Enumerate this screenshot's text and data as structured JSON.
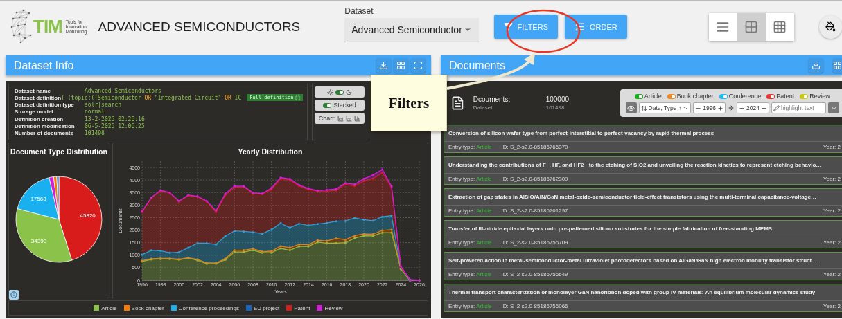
{
  "header": {
    "logo": {
      "mark": "TIM",
      "tagline": "Tools for Innovation Monitoring"
    },
    "title": "ADVANCED SEMICONDUCTORS",
    "dataset_label": "Dataset",
    "dataset_value": "Advanced Semiconductor",
    "filters_button": "FILTERS",
    "order_button": "ORDER",
    "view_modes": [
      {
        "kind": "list",
        "selected": false
      },
      {
        "kind": "grid4",
        "selected": true
      },
      {
        "kind": "grid9",
        "selected": false
      }
    ]
  },
  "annotation": {
    "callout": "Filters"
  },
  "dataset_info": {
    "title": "Dataset Info",
    "fields": [
      {
        "label": "Dataset name",
        "parts": [
          {
            "kind": "plain",
            "text": "Advanced Semiconductors"
          }
        ]
      },
      {
        "label": "Dataset definition",
        "parts": [
          {
            "kind": "plain",
            "text": "( (topic:((Semiconductor "
          },
          {
            "kind": "keyword",
            "text": "OR"
          },
          {
            "kind": "plain",
            "text": " \"Integrated Circuit\" "
          },
          {
            "kind": "keyword",
            "text": "OR"
          },
          {
            "kind": "plain",
            "text": " IC"
          }
        ],
        "badge": "Full definition"
      },
      {
        "label": "Dataset definition type",
        "parts": [
          {
            "kind": "plain",
            "text": "solr|search"
          }
        ]
      },
      {
        "label": "Storage model",
        "parts": [
          {
            "kind": "plain",
            "text": "normal"
          }
        ]
      },
      {
        "label": "Definition creation",
        "parts": [
          {
            "kind": "plain",
            "text": "13-2-2025 02:26:16"
          }
        ]
      },
      {
        "label": "Definition modification",
        "parts": [
          {
            "kind": "plain",
            "text": "06-5-2025 12:06:25"
          }
        ]
      },
      {
        "label": "Number of documents",
        "parts": [
          {
            "kind": "plain",
            "text": "101498"
          }
        ]
      }
    ],
    "dark_mode": true,
    "stacked": {
      "label": "Stacked",
      "on": true
    },
    "chart_label": "Chart:",
    "pie": {
      "title": "Document Type Distribution",
      "chart_data": {
        "type": "pie",
        "colors": [
          "#d81b1b",
          "#8bc34a",
          "#1ab0f0",
          "#d21fd8",
          "#f57c00",
          "#1565c0"
        ],
        "values": [
          45820,
          34390,
          17568,
          1700,
          1200,
          820
        ],
        "value_labels": [
          "45820",
          "34390",
          "17568",
          null,
          null,
          null
        ]
      }
    },
    "yearly": {
      "title": "Yearly Distribution",
      "chart_data": {
        "type": "area",
        "stacked": true,
        "xlabel": "Years",
        "ylabel": "Documents",
        "x": [
          1996,
          1997,
          1998,
          1999,
          2000,
          2001,
          2002,
          2003,
          2004,
          2005,
          2006,
          2007,
          2008,
          2009,
          2010,
          2011,
          2012,
          2013,
          2014,
          2015,
          2016,
          2017,
          2018,
          2019,
          2020,
          2021,
          2022,
          2023,
          2024,
          2025,
          2026
        ],
        "xticks": [
          1996,
          1998,
          2000,
          2002,
          2004,
          2006,
          2008,
          2010,
          2012,
          2014,
          2016,
          2018,
          2020,
          2022,
          2024,
          2026
        ],
        "yticks": [
          0,
          500,
          1000,
          1500,
          2000,
          2500,
          3000,
          3500,
          4000,
          4500
        ],
        "ylim": [
          0,
          4750
        ],
        "xlim": [
          1996,
          2026
        ],
        "grid": true,
        "series": [
          {
            "name": "Article",
            "color": "#8bc34a",
            "values": [
              750,
              830,
              850,
              850,
              820,
              880,
              800,
              660,
              660,
              820,
              1130,
              1130,
              1200,
              1100,
              1100,
              1270,
              1200,
              1350,
              1350,
              1520,
              1480,
              1480,
              1500,
              1680,
              1780,
              1770,
              1900,
              1900,
              450,
              0,
              0
            ]
          },
          {
            "name": "Book chapter",
            "color": "#f57c00",
            "values": [
              30,
              30,
              20,
              20,
              20,
              20,
              30,
              30,
              30,
              40,
              70,
              70,
              60,
              40,
              60,
              90,
              100,
              80,
              70,
              80,
              90,
              190,
              120,
              100,
              70,
              70,
              90,
              120,
              30,
              0,
              0
            ]
          },
          {
            "name": "Conference proceedings",
            "color": "#1ab0f0",
            "values": [
              240,
              340,
              310,
              230,
              280,
              400,
              650,
              790,
              740,
              900,
              770,
              750,
              660,
              720,
              860,
              920,
              800,
              830,
              770,
              650,
              720,
              690,
              750,
              710,
              570,
              540,
              550,
              560,
              20,
              0,
              0
            ]
          },
          {
            "name": "EU project",
            "color": "#1565c0",
            "values": [
              null,
              null,
              null,
              null,
              null,
              null,
              null,
              null,
              null,
              null,
              null,
              null,
              null,
              null,
              null,
              null,
              null,
              null,
              null,
              null,
              null,
              null,
              null,
              null,
              null,
              null,
              null,
              null,
              null,
              null,
              null
            ]
          },
          {
            "name": "Patent",
            "color": "#d81b1b",
            "values": [
              1700,
              2080,
              2380,
              2380,
              2020,
              2080,
              1850,
              1660,
              1290,
              1640,
              1730,
              1780,
              1540,
              1580,
              1600,
              1780,
              1900,
              1500,
              1430,
              1300,
              1270,
              1220,
              1460,
              1270,
              1540,
              1680,
              1750,
              1120,
              20,
              20,
              0
            ]
          },
          {
            "name": "Review",
            "color": "#d21fd8",
            "values": [
              30,
              20,
              30,
              20,
              20,
              20,
              20,
              20,
              60,
              50,
              60,
              20,
              30,
              20,
              60,
              40,
              40,
              40,
              40,
              30,
              50,
              60,
              50,
              70,
              90,
              140,
              130,
              50,
              40,
              10,
              0
            ]
          }
        ]
      }
    }
  },
  "documents": {
    "title": "Documents",
    "count_label": "Dcouments:",
    "count": "100000",
    "dataset_label": "Dataset:",
    "dataset_count": "101498",
    "type_toggles": [
      {
        "label": "Article",
        "color": "#22a822",
        "on": true
      },
      {
        "label": "Book chapter",
        "color": "#f08a24",
        "on": true
      },
      {
        "label": "Conference",
        "color": "#29b6f6",
        "on": true
      },
      {
        "label": "Patent",
        "color": "#e53935",
        "on": true
      },
      {
        "label": "Review",
        "color": "#c9c716",
        "on": true
      }
    ],
    "sort": "Date, Type ↑",
    "year_from": "1996",
    "year_to": "2024",
    "highlight_placeholder": "highlight text",
    "items": [
      {
        "title": "Conversion of silicon wafer type from perfect-interstitial to perfect-vacancy by rapid thermal process",
        "entry_label": "Entry type:",
        "entry_type": "Article",
        "id": "ID: S_2-s2.0-85186766370",
        "year": "Year: 2"
      },
      {
        "title": "Understanding the contributions of F−, HF, and HF2− to the etching of SiO2 and unveiling the reaction kinetics to represent etching behavio…",
        "entry_label": "Entry type:",
        "entry_type": "Article",
        "id": "ID: S_2-s2.0-85186762309",
        "year": "Year: 2"
      },
      {
        "title": "Extraction of gap states in AlSiO/AlN/GaN metal-oxide-semiconductor field-effect transistors using the multi-terminal capacitance-voltage…",
        "entry_label": "Entry type:",
        "entry_type": "Article",
        "id": "ID: S_2-s2.0-85186761297",
        "year": "Year: 2"
      },
      {
        "title": "Transfer of III-nitride epitaxial layers onto pre-patterned silicon substrates for the simple fabrication of free-standing MEMS",
        "entry_label": "Entry type:",
        "entry_type": "Article",
        "id": "ID: S_2-s2.0-85186756709",
        "year": "Year: 2"
      },
      {
        "title": "Self-powered action in metal-semiconductor-metal ultraviolet photodetectors based on AlGaN/GaN high electron mobility transistor struct…",
        "entry_label": "Entry type:",
        "entry_type": "Article",
        "id": "ID: S_2-s2.0-85186756649",
        "year": "Year: 2"
      },
      {
        "title": "Thermal transport characterization of monolayer GaN nanoribbon doped with group IV materials: An equilibrium molecular dynamics study",
        "entry_label": "Entry type:",
        "entry_type": "Article",
        "id": "ID: S_2-s2.0-85186756066",
        "year": "Year: 2"
      }
    ]
  }
}
